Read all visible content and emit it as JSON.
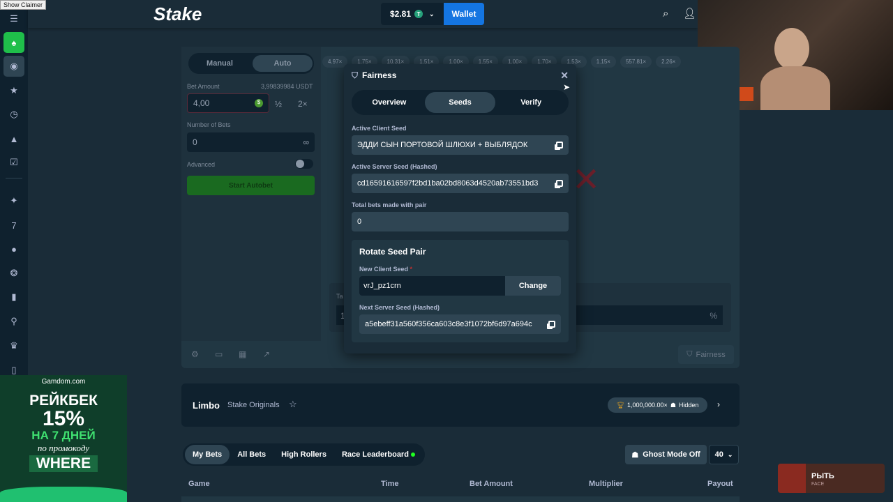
{
  "overlay": {
    "claimer": "Show Claimer"
  },
  "header": {
    "logo": "Stake",
    "balance": "$2.81",
    "currency_icon": "T",
    "wallet": "Wallet"
  },
  "controls": {
    "tabs": [
      "Manual",
      "Auto"
    ],
    "bet_amount_label": "Bet Amount",
    "balance_hint": "3,99839984 USDT",
    "bet_amount": "4,00",
    "half": "½",
    "double": "2×",
    "num_bets_label": "Number of Bets",
    "num_bets": "0",
    "infinity": "∞",
    "advanced": "Advanced",
    "start": "Start Autobet"
  },
  "multipliers": [
    "4.97×",
    "1.75×",
    "10.31×",
    "1.51×",
    "1.00×",
    "1.55×",
    "1.00×",
    "1.70×",
    "1.53×",
    "1.15×",
    "557.81×",
    "2.26×"
  ],
  "game": {
    "target_label": "Ta",
    "target_value": "1",
    "win_chance_suffix": "%",
    "fairness": "Fairness"
  },
  "modal": {
    "title": "Fairness",
    "tabs": [
      "Overview",
      "Seeds",
      "Verify"
    ],
    "active_tab": "Seeds",
    "client_seed_label": "Active Client Seed",
    "client_seed": "ЭДДИ СЫН ПОРТОВОЙ ШЛЮХИ + ВЫБЛЯДОК",
    "server_seed_label": "Active Server Seed (Hashed)",
    "server_seed": "cd16591616597f2bd1ba02bd8063d4520ab73551bd3",
    "total_bets_label": "Total bets made with pair",
    "total_bets": "0",
    "rotate_title": "Rotate Seed Pair",
    "new_client_label": "New Client Seed",
    "required": "*",
    "new_client_value": "vrJ_pz1crn",
    "change": "Change",
    "next_server_label": "Next Server Seed (Hashed)",
    "next_server": "a5ebeff31a560f356ca603c8e3f1072bf6d97a694c"
  },
  "limbo": {
    "title": "Limbo",
    "subtitle": "Stake Originals",
    "max_win": "1,000,000.00×",
    "hidden": "Hidden"
  },
  "bets": {
    "tabs": [
      "My Bets",
      "All Bets",
      "High Rollers",
      "Race Leaderboard"
    ],
    "ghost": "Ghost Mode Off",
    "page_size": "40",
    "columns": [
      "Game",
      "Time",
      "Bet Amount",
      "Multiplier",
      "Payout"
    ]
  },
  "ad": {
    "brand": "Gamdom.com",
    "l1": "РЕЙКБЕК",
    "l2": "15%",
    "l3": "НА 7 ДНЕЙ",
    "l4": "по промокоду",
    "l5": "WHERE"
  },
  "notification": {
    "title": "РЫТЬ",
    "subtitle": "FACE"
  }
}
